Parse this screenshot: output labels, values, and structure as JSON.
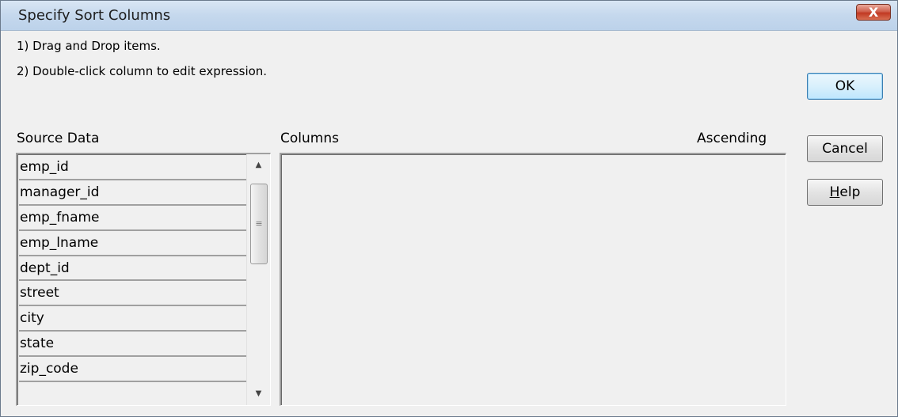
{
  "dialog": {
    "title": "Specify Sort Columns",
    "close_label": "X"
  },
  "instructions": [
    "1) Drag and Drop items.",
    "2) Double-click column to edit expression."
  ],
  "source": {
    "label": "Source Data",
    "items": [
      "emp_id",
      "manager_id",
      "emp_fname",
      "emp_lname",
      "dept_id",
      "street",
      "city",
      "state",
      "zip_code"
    ],
    "scroll_up_icon": "▲",
    "scroll_down_icon": "▼",
    "thumb_grip_icon": "≡"
  },
  "columns": {
    "label": "Columns",
    "ascending_label": "Ascending"
  },
  "buttons": {
    "ok": "OK",
    "cancel": "Cancel",
    "help": "Help",
    "help_mnemonic": "H"
  }
}
